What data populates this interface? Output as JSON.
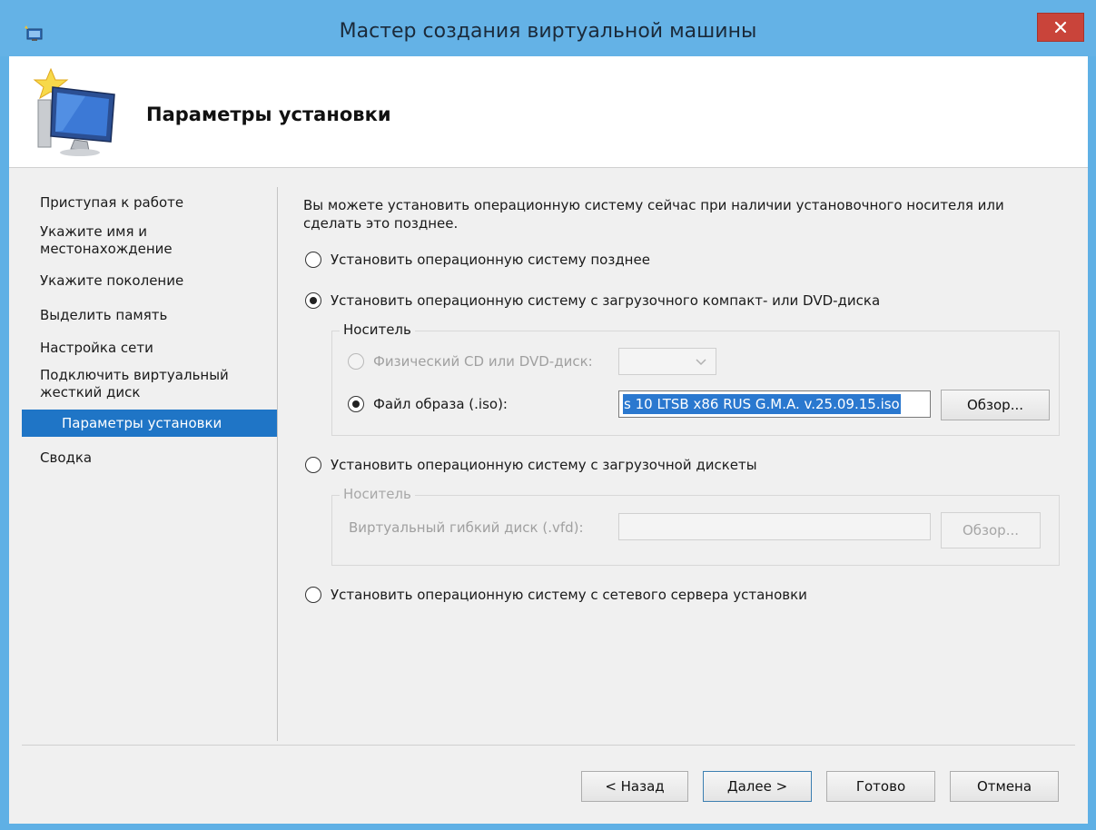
{
  "window": {
    "title": "Мастер создания виртуальной машины",
    "close_icon": "close-icon"
  },
  "header": {
    "title": "Параметры установки",
    "icon": "new-vm-wizard-icon"
  },
  "nav": {
    "items": [
      {
        "label": "Приступая к работе",
        "active": false
      },
      {
        "label": "Укажите имя и\nместонахождение",
        "active": false
      },
      {
        "label": "Укажите поколение",
        "active": false
      },
      {
        "label": "Выделить память",
        "active": false
      },
      {
        "label": "Настройка сети",
        "active": false
      },
      {
        "label": "Подключить виртуальный\nжесткий диск",
        "active": false
      },
      {
        "label": "Параметры установки",
        "active": true
      },
      {
        "label": "Сводка",
        "active": false
      }
    ]
  },
  "main": {
    "intro": "Вы можете установить операционную систему сейчас при наличии установочного носителя или сделать это позднее.",
    "options": {
      "later": {
        "label": "Установить операционную систему позднее",
        "checked": false
      },
      "dvd": {
        "label": "Установить операционную систему с загрузочного компакт- или DVD-диска",
        "checked": true
      },
      "floppy": {
        "label": "Установить операционную систему с загрузочной дискеты",
        "checked": false
      },
      "network": {
        "label": "Установить операционную систему с сетевого сервера установки",
        "checked": false
      }
    },
    "dvd_group": {
      "legend": "Носитель",
      "physical_label": "Физический CD или DVD-диск:",
      "physical_checked": false,
      "physical_disabled": true,
      "physical_value": "",
      "iso_label": "Файл образа (.iso):",
      "iso_checked": true,
      "iso_value": "s 10 LTSB x86 RUS G.M.A. v.25.09.15.iso",
      "browse_label": "Обзор..."
    },
    "floppy_group": {
      "legend": "Носитель",
      "vfd_label": "Виртуальный гибкий диск (.vfd):",
      "vfd_value": "",
      "browse_label": "Обзор..."
    }
  },
  "footer": {
    "back_label": "< Назад",
    "next_label": "Далее >",
    "finish_label": "Готово",
    "cancel_label": "Отмена"
  },
  "colors": {
    "titlebar": "#64b2e6",
    "close": "#c9443a",
    "nav_active": "#1f75c6",
    "selection": "#2a78cf"
  }
}
